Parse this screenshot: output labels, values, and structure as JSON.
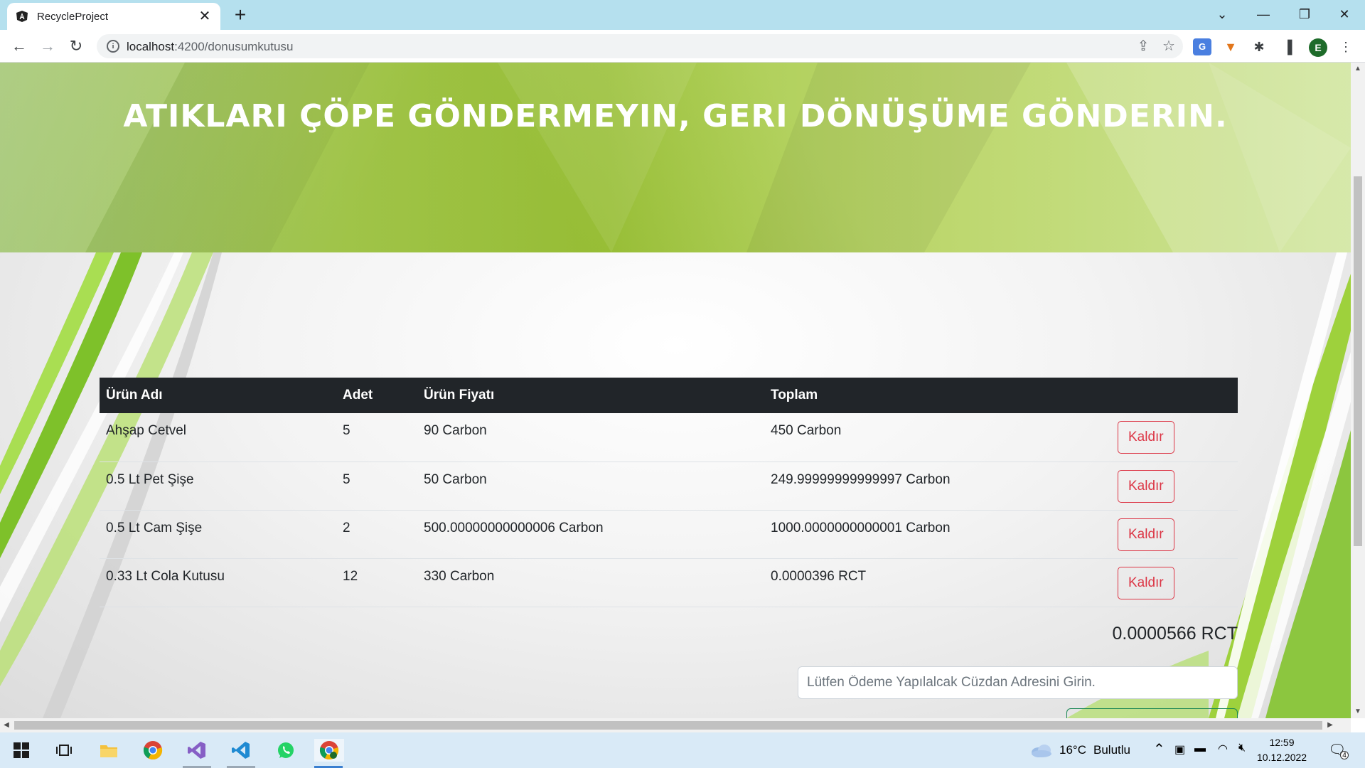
{
  "browser": {
    "tab_title": "RecycleProject",
    "tab_close": "✕",
    "new_tab": "+",
    "url_host": "localhost",
    "url_port_path": ":4200/donusumkutusu",
    "profile_letter": "E",
    "icons": {
      "back": "arrow-left-icon",
      "forward": "arrow-right-icon",
      "reload": "reload-icon",
      "share": "share-icon",
      "bookmark": "star-icon",
      "translate": "google-translate-icon",
      "metamask": "metamask-fox-icon",
      "extensions": "puzzle-icon",
      "sidepanel": "side-panel-icon",
      "menu": "kebab-menu-icon"
    }
  },
  "page": {
    "hero_title": "ATIKLARI ÇÖPE GÖNDERMEYIN, GERI DÖNÜŞÜME GÖNDERIN.",
    "table": {
      "headers": [
        "Ürün Adı",
        "Adet",
        "Ürün Fiyatı",
        "Toplam",
        ""
      ],
      "rows": [
        {
          "name": "Ahşap Cetvel",
          "qty": "5",
          "price": "90 Carbon",
          "total": "450 Carbon",
          "action": "Kaldır"
        },
        {
          "name": "0.5 Lt Pet Şişe",
          "qty": "5",
          "price": "50 Carbon",
          "total": "249.99999999999997 Carbon",
          "action": "Kaldır"
        },
        {
          "name": "0.5 Lt Cam Şişe",
          "qty": "2",
          "price": "500.00000000000006 Carbon",
          "total": "1000.0000000000001 Carbon",
          "action": "Kaldır"
        },
        {
          "name": "0.33 Lt Cola Kutusu",
          "qty": "12",
          "price": "330 Carbon",
          "total": "0.0000396 RCT",
          "action": "Kaldır"
        }
      ]
    },
    "grand_total": "0.0000566 RCT",
    "wallet_placeholder": "Lütfen Ödeme Yapılalcak Cüzdan Adresini Girin."
  },
  "taskbar": {
    "weather_temp": "16°C",
    "weather_desc": "Bulutlu",
    "time": "12:59",
    "date": "10.12.2022",
    "notification_count": "4"
  },
  "colors": {
    "hero_green": "#a6cc4c",
    "table_header_bg": "#212529",
    "danger": "#dc3545",
    "tabbar_bg": "#b5e0ee",
    "taskbar_bg": "#d9eaf7"
  }
}
